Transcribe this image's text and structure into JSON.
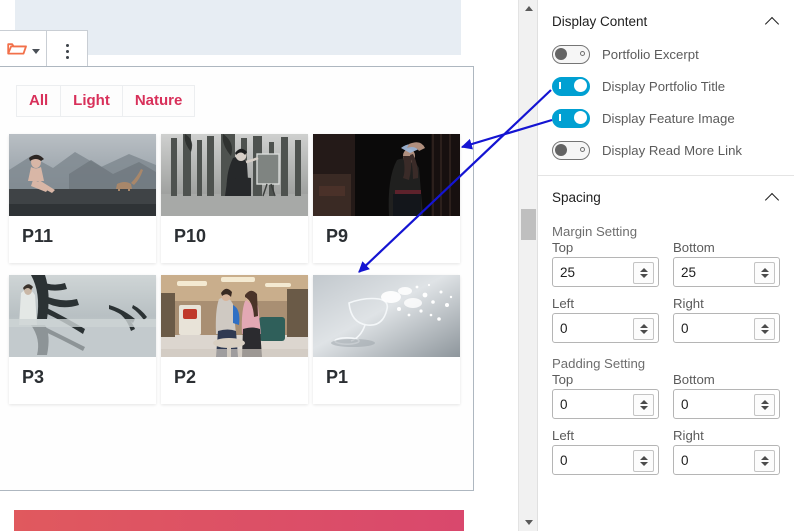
{
  "editor": {
    "toolbar": {
      "block_icon": "open-folder-icon",
      "block_icon_color": "#f2704a",
      "dropdown_icon": "caret-down-icon",
      "more_icon": "vertical-dots-icon"
    },
    "filters": [
      {
        "label": "All"
      },
      {
        "label": "Light"
      },
      {
        "label": "Nature"
      }
    ],
    "filter_color": "#d8305a",
    "grid": {
      "rows": [
        [
          {
            "title": "P11",
            "image": "woman-sitting-on-log-with-cat-mountains"
          },
          {
            "title": "P10",
            "image": "woman-painting-at-easel-bw-trees"
          },
          {
            "title": "P9",
            "image": "woman-in-dark-doorway-holding-paper"
          }
        ],
        [
          {
            "title": "P3",
            "image": "bride-by-tree-misty-lake"
          },
          {
            "title": "P2",
            "image": "two-women-shopping-mall"
          },
          {
            "title": "P1",
            "image": "wine-glass-water-splash"
          }
        ]
      ]
    }
  },
  "scrollbar": {
    "up_icon": "scroll-up-arrow-icon",
    "down_icon": "scroll-down-arrow-icon"
  },
  "sidebar": {
    "sections": [
      {
        "title": "Display Content",
        "collapse_icon": "chevron-up-icon",
        "toggles": [
          {
            "label": "Portfolio Excerpt",
            "state": "off"
          },
          {
            "label": "Display Portfolio Title",
            "state": "on"
          },
          {
            "label": "Display Feature Image",
            "state": "on"
          },
          {
            "label": "Display Read More Link",
            "state": "off"
          }
        ]
      },
      {
        "title": "Spacing",
        "collapse_icon": "chevron-up-icon",
        "groups": [
          {
            "label": "Margin Setting",
            "fields": [
              {
                "label": "Top",
                "value": "25"
              },
              {
                "label": "Bottom",
                "value": "25"
              },
              {
                "label": "Left",
                "value": "0"
              },
              {
                "label": "Right",
                "value": "0"
              }
            ]
          },
          {
            "label": "Padding Setting",
            "fields": [
              {
                "label": "Top",
                "value": "0"
              },
              {
                "label": "Bottom",
                "value": "0"
              },
              {
                "label": "Left",
                "value": "0"
              },
              {
                "label": "Right",
                "value": "0"
              }
            ]
          }
        ]
      }
    ],
    "toggle_on_color": "#00a0d2"
  },
  "annotations": {
    "arrow_color": "#1414d2",
    "arrows": [
      {
        "name": "arrow-to-feature-image",
        "from": "Display Feature Image toggle",
        "to": "P9 feature image"
      },
      {
        "name": "arrow-to-portfolio-title",
        "from": "Display Portfolio Title toggle",
        "to": "P9 title"
      }
    ]
  }
}
